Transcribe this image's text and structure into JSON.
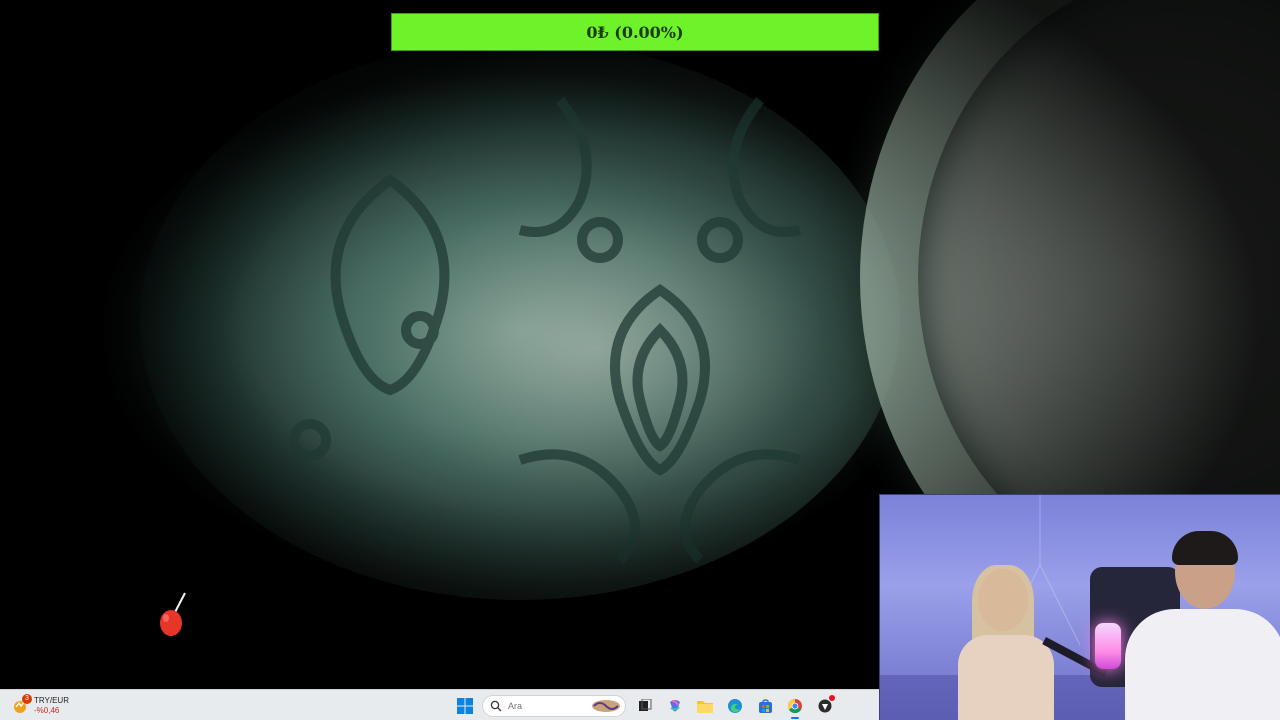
{
  "hud": {
    "balance_text": "0₺ (0.00%)"
  },
  "taskbar": {
    "widget": {
      "badge": "3",
      "title": "TRY/EUR",
      "value": "-%0,46",
      "icon": "currency-widget-icon"
    },
    "search": {
      "placeholder": "Ara"
    },
    "apps": [
      {
        "name": "start-icon"
      },
      {
        "name": "task-view-icon"
      },
      {
        "name": "copilot-icon"
      },
      {
        "name": "file-explorer-icon"
      },
      {
        "name": "edge-icon"
      },
      {
        "name": "store-icon"
      },
      {
        "name": "chrome-icon"
      },
      {
        "name": "app-icon"
      }
    ]
  },
  "colors": {
    "hud_bar": "#6ef22a",
    "taskbar": "#e8ebee",
    "alert_icon": "#e8352a",
    "active_indicator": "#1a73e8"
  }
}
